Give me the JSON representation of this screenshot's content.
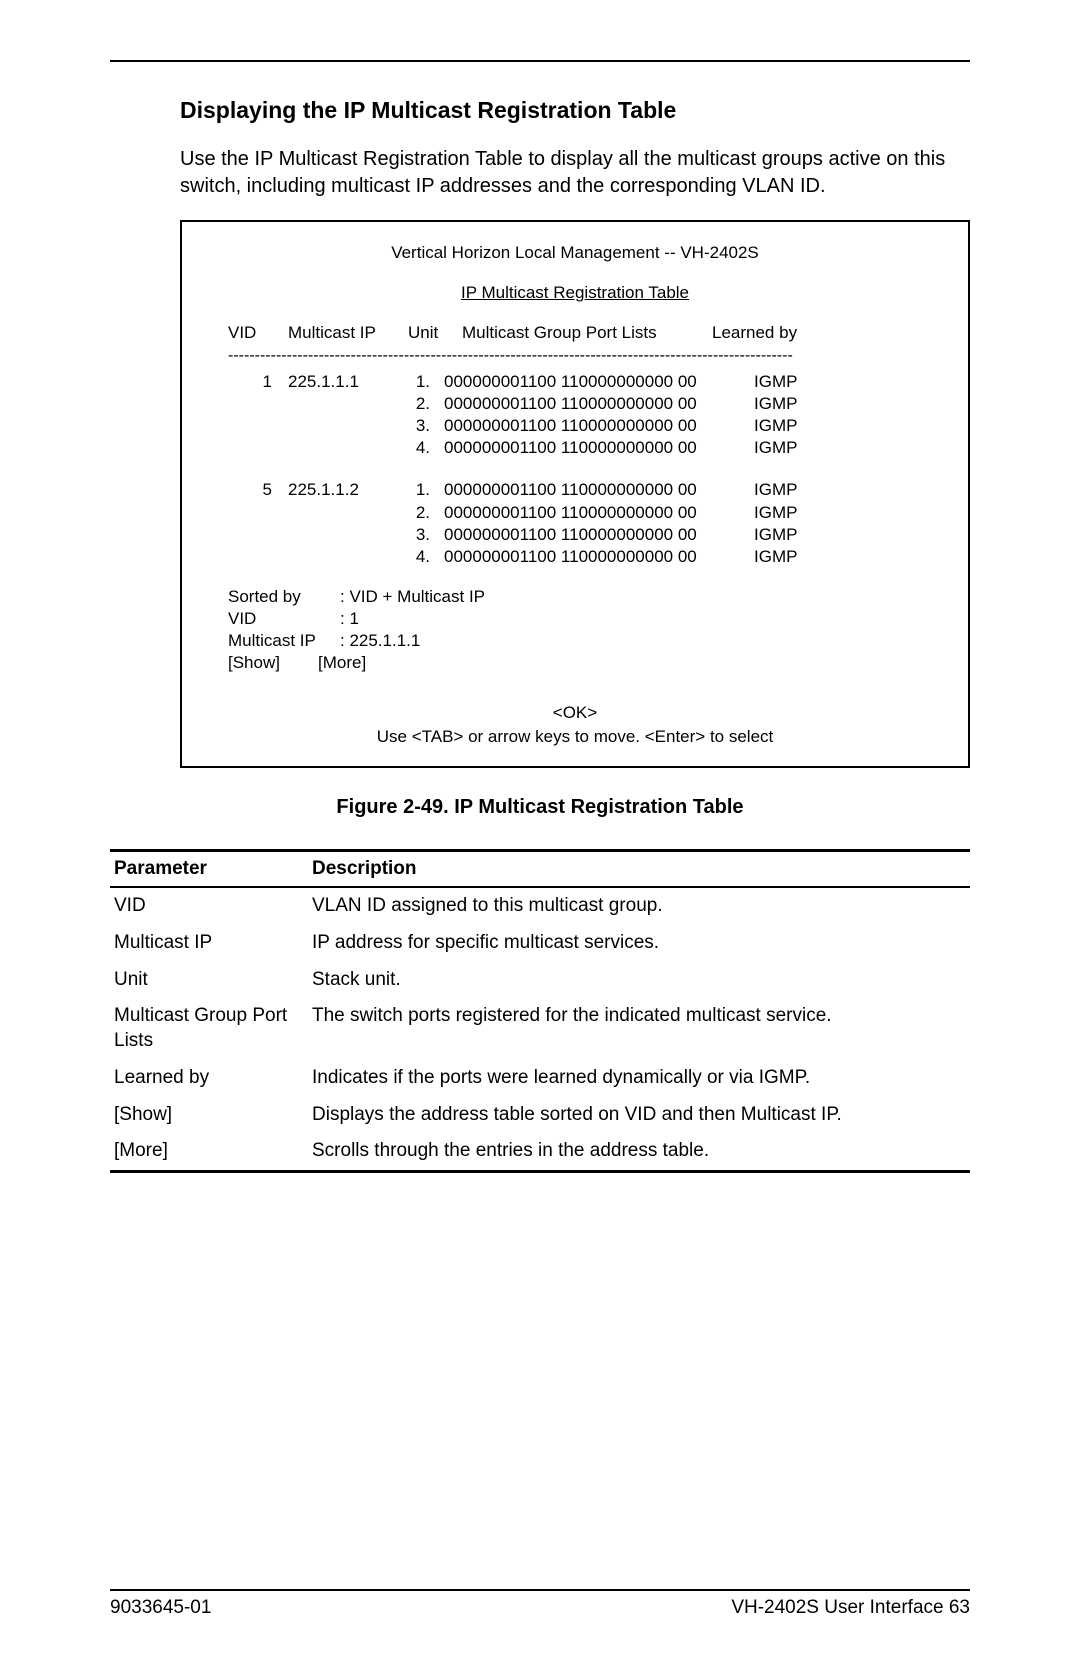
{
  "section_title": "Displaying the IP Multicast Registration Table",
  "intro": "Use the IP Multicast Registration Table to display all the multicast groups active on this switch, including multicast IP addresses and the corresponding VLAN ID.",
  "terminal": {
    "title": "Vertical Horizon Local Management -- VH-2402S",
    "subtitle": "IP Multicast Registration Table",
    "headers": {
      "vid": "VID",
      "multicast_ip": "Multicast IP",
      "unit": "Unit",
      "ports": "Multicast Group Port Lists",
      "learned": "Learned by"
    },
    "dashes": "----------------------------------------------------------------------------------------------------------",
    "groups": [
      {
        "vid": "1",
        "mip": "225.1.1.1",
        "rows": [
          {
            "unit": "1.",
            "ports": "000000001100 110000000000 00",
            "learned": "IGMP"
          },
          {
            "unit": "2.",
            "ports": "000000001100 110000000000 00",
            "learned": "IGMP"
          },
          {
            "unit": "3.",
            "ports": "000000001100 110000000000 00",
            "learned": "IGMP"
          },
          {
            "unit": "4.",
            "ports": "000000001100 110000000000 00",
            "learned": "IGMP"
          }
        ]
      },
      {
        "vid": "5",
        "mip": "225.1.1.2",
        "rows": [
          {
            "unit": "1.",
            "ports": "000000001100 110000000000 00",
            "learned": "IGMP"
          },
          {
            "unit": "2.",
            "ports": "000000001100 110000000000 00",
            "learned": "IGMP"
          },
          {
            "unit": "3.",
            "ports": "000000001100 110000000000 00",
            "learned": "IGMP"
          },
          {
            "unit": "4.",
            "ports": "000000001100 110000000000 00",
            "learned": "IGMP"
          }
        ]
      }
    ],
    "sorted": {
      "sorted_by_label": "Sorted by",
      "sorted_by_value": ": VID + Multicast IP",
      "vid_label": "VID",
      "vid_value": ": 1",
      "mip_label": "Multicast IP",
      "mip_value": ": 225.1.1.1",
      "show": "[Show]",
      "more": "[More]"
    },
    "ok": "<OK>",
    "hint": "Use <TAB> or arrow keys to move. <Enter> to select"
  },
  "figure_caption": "Figure 2-49.  IP Multicast Registration Table",
  "param_table": {
    "headers": {
      "param": "Parameter",
      "desc": "Description"
    },
    "rows": [
      {
        "param": "VID",
        "desc": "VLAN ID assigned to this multicast group."
      },
      {
        "param": "Multicast IP",
        "desc": "IP address for specific multicast services."
      },
      {
        "param": "Unit",
        "desc": "Stack unit."
      },
      {
        "param": "Multicast Group Port Lists",
        "desc": "The switch ports registered for the indicated multicast service."
      },
      {
        "param": "Learned by",
        "desc": "Indicates if the ports were learned dynamically or via IGMP."
      },
      {
        "param": "[Show]",
        "desc": "Displays the address table sorted on VID and then Multicast IP."
      },
      {
        "param": "[More]",
        "desc": "Scrolls through the entries in the address table."
      }
    ]
  },
  "footer": {
    "left": "9033645-01",
    "right": "VH-2402S User Interface  63"
  }
}
